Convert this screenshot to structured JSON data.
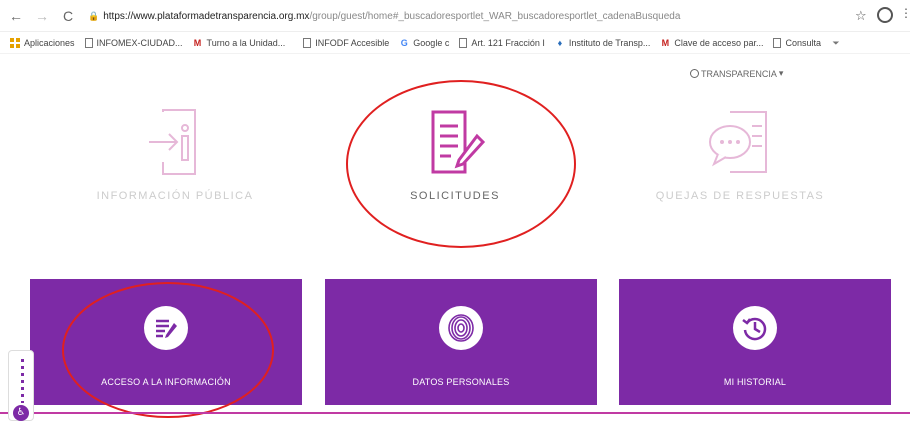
{
  "browser": {
    "url_domain": "https://www.plataformadetransparencia.org.mx",
    "url_path": "/group/guest/home#_buscadoresportlet_WAR_buscadoresportlet_cadenaBusqueda",
    "bookmarks": [
      {
        "label": "Aplicaciones",
        "icon": "apps-grid-icon"
      },
      {
        "label": "INFOMEX-CIUDAD...",
        "icon": "page-icon"
      },
      {
        "label": "Turno a la Unidad...",
        "icon": "gmail-icon"
      },
      {
        "label": "INFODF Accesible",
        "icon": "page-icon"
      },
      {
        "label": "Google c",
        "icon": "google-icon"
      },
      {
        "label": "Art. 121 Fracción I",
        "icon": "page-icon"
      },
      {
        "label": "Instituto de Transp...",
        "icon": "institute-icon"
      },
      {
        "label": "Clave de acceso par...",
        "icon": "gmail-icon"
      },
      {
        "label": "Consulta",
        "icon": "page-icon"
      }
    ]
  },
  "header": {
    "menu_label": "TRANSPARENCIA",
    "menu_caret": "▾"
  },
  "top_items": [
    {
      "label": "INFORMACIÓN PÚBLICA"
    },
    {
      "label": "SOLICITUDES"
    },
    {
      "label": "QUEJAS DE RESPUESTAS"
    }
  ],
  "cards": [
    {
      "label": "ACCESO A LA INFORMACIÓN"
    },
    {
      "label": "DATOS PERSONALES"
    },
    {
      "label": "MI HISTORIAL"
    }
  ],
  "colors": {
    "accent_purple": "#7d2aa6",
    "icon_pink": "#c03aa3",
    "annotation_red": "#e02020"
  }
}
